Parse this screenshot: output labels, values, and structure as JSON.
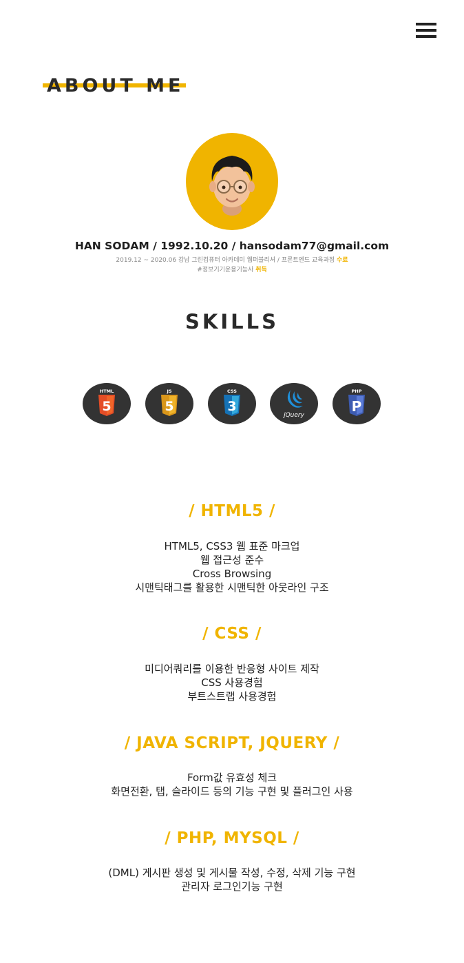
{
  "header": {
    "menu_icon": "hamburger-menu-icon"
  },
  "about": {
    "title": "ABOUT ME"
  },
  "profile": {
    "name_line": "HAN SODAM / 1992.10.20 / hansodam77@gmail.com",
    "education_text": "2019.12 ~ 2020.06 강남 그린컴퓨터 아카데미 웹퍼블리셔 / 프론트엔드 교육과정",
    "education_status": "수료",
    "certificate_text": "#정보기기운용기능사",
    "certificate_status": "취득",
    "avatar_icon": "memoji-avatar-icon"
  },
  "skills": {
    "title": "SKILLS",
    "icons": [
      {
        "name": "html5-icon",
        "label": "HTML",
        "color": "#e44d26"
      },
      {
        "name": "js-icon",
        "label": "JS",
        "color": "#e9a421"
      },
      {
        "name": "css3-icon",
        "label": "CSS",
        "color": "#1b73ba"
      },
      {
        "name": "jquery-icon",
        "label": "jQuery",
        "color": "#0769ad"
      },
      {
        "name": "php-icon",
        "label": "PHP",
        "color": "#3d5bb0"
      }
    ]
  },
  "sections": [
    {
      "title": "/ HTML5 /",
      "lines": [
        "HTML5, CSS3 웹 표준 마크업",
        "웹 접근성 준수",
        "Cross Browsing",
        "시맨틱태그를 활용한 시맨틱한 아웃라인 구조"
      ]
    },
    {
      "title": "/ CSS /",
      "lines": [
        "미디어쿼리를 이용한 반응형 사이트 제작",
        "CSS 사용경험",
        "부트스트랩 사용경험"
      ]
    },
    {
      "title": "/ JAVA SCRIPT, JQUERY /",
      "lines": [
        "Form값 유효성 체크",
        "화면전환, 탭, 슬라이드 등의 기능 구현 및 플러그인 사용"
      ]
    },
    {
      "title": "/ PHP, MYSQL /",
      "lines": [
        "(DML) 게시판 생성 및 게시물 작성, 수정, 삭제 기능 구현",
        "관리자 로그인기능 구현"
      ]
    }
  ],
  "colors": {
    "accent": "#f0b400",
    "dark": "#2a2a2a",
    "icon_bg": "#333333"
  }
}
